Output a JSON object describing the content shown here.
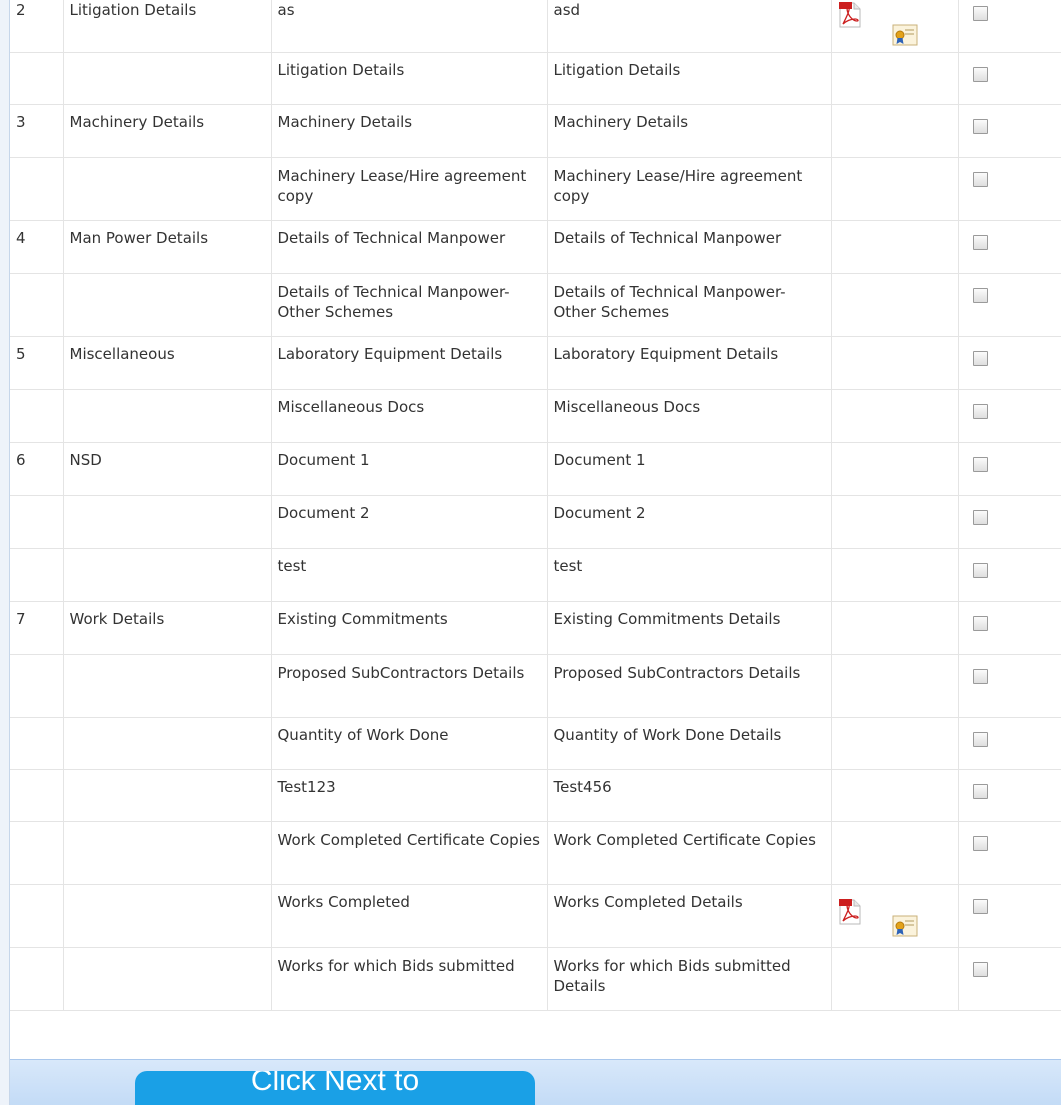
{
  "rows": [
    {
      "no": "2",
      "category": "Litigation Details",
      "document": "as",
      "description": "asd",
      "has_files": true
    },
    {
      "no": "",
      "category": "",
      "document": "Litigation Details",
      "description": "Litigation Details",
      "has_files": false
    },
    {
      "no": "3",
      "category": "Machinery Details",
      "document": "Machinery Details",
      "description": "Machinery Details",
      "has_files": false
    },
    {
      "no": "",
      "category": "",
      "document": "Machinery Lease/Hire agreement copy",
      "description": "Machinery Lease/Hire agreement copy",
      "has_files": false
    },
    {
      "no": "4",
      "category": "Man Power Details",
      "document": "Details of Technical Manpower",
      "description": "Details of Technical Manpower",
      "has_files": false
    },
    {
      "no": "",
      "category": "",
      "document": "Details of Technical Manpower-Other Schemes",
      "description": "Details of Technical Manpower-Other Schemes",
      "has_files": false
    },
    {
      "no": "5",
      "category": "Miscellaneous",
      "document": "Laboratory Equipment Details",
      "description": "Laboratory Equipment Details",
      "has_files": false
    },
    {
      "no": "",
      "category": "",
      "document": "Miscellaneous Docs",
      "description": "Miscellaneous Docs",
      "has_files": false
    },
    {
      "no": "6",
      "category": "NSD",
      "document": "Document 1",
      "description": "Document 1",
      "has_files": false
    },
    {
      "no": "",
      "category": "",
      "document": "Document 2",
      "description": "Document 2",
      "has_files": false
    },
    {
      "no": "",
      "category": "",
      "document": "test",
      "description": "test",
      "has_files": false
    },
    {
      "no": "7",
      "category": "Work Details",
      "document": "Existing Commitments",
      "description": "Existing Commitments Details",
      "has_files": false
    },
    {
      "no": "",
      "category": "",
      "document": "Proposed SubContractors Details",
      "description": "Proposed SubContractors Details",
      "has_files": false
    },
    {
      "no": "",
      "category": "",
      "document": "Quantity of Work Done",
      "description": "Quantity of Work Done Details",
      "has_files": false
    },
    {
      "no": "",
      "category": "",
      "document": "Test123",
      "description": "Test456",
      "has_files": false
    },
    {
      "no": "",
      "category": "",
      "document": "Work Completed Certificate Copies",
      "description": "Work Completed Certificate Copies",
      "has_files": false
    },
    {
      "no": "",
      "category": "",
      "document": "Works Completed",
      "description": "Works Completed Details",
      "has_files": true
    },
    {
      "no": "",
      "category": "",
      "document": "Works for which Bids submitted",
      "description": "Works for which Bids submitted Details",
      "has_files": false
    }
  ],
  "next_button": {
    "label": "Click Next to"
  },
  "icons": {
    "pdf": "pdf-file-icon",
    "certificate": "certificate-icon"
  },
  "colors": {
    "button": "#1aa0e6",
    "band": "#c3dbf6",
    "grid": "#e4e4e4"
  }
}
